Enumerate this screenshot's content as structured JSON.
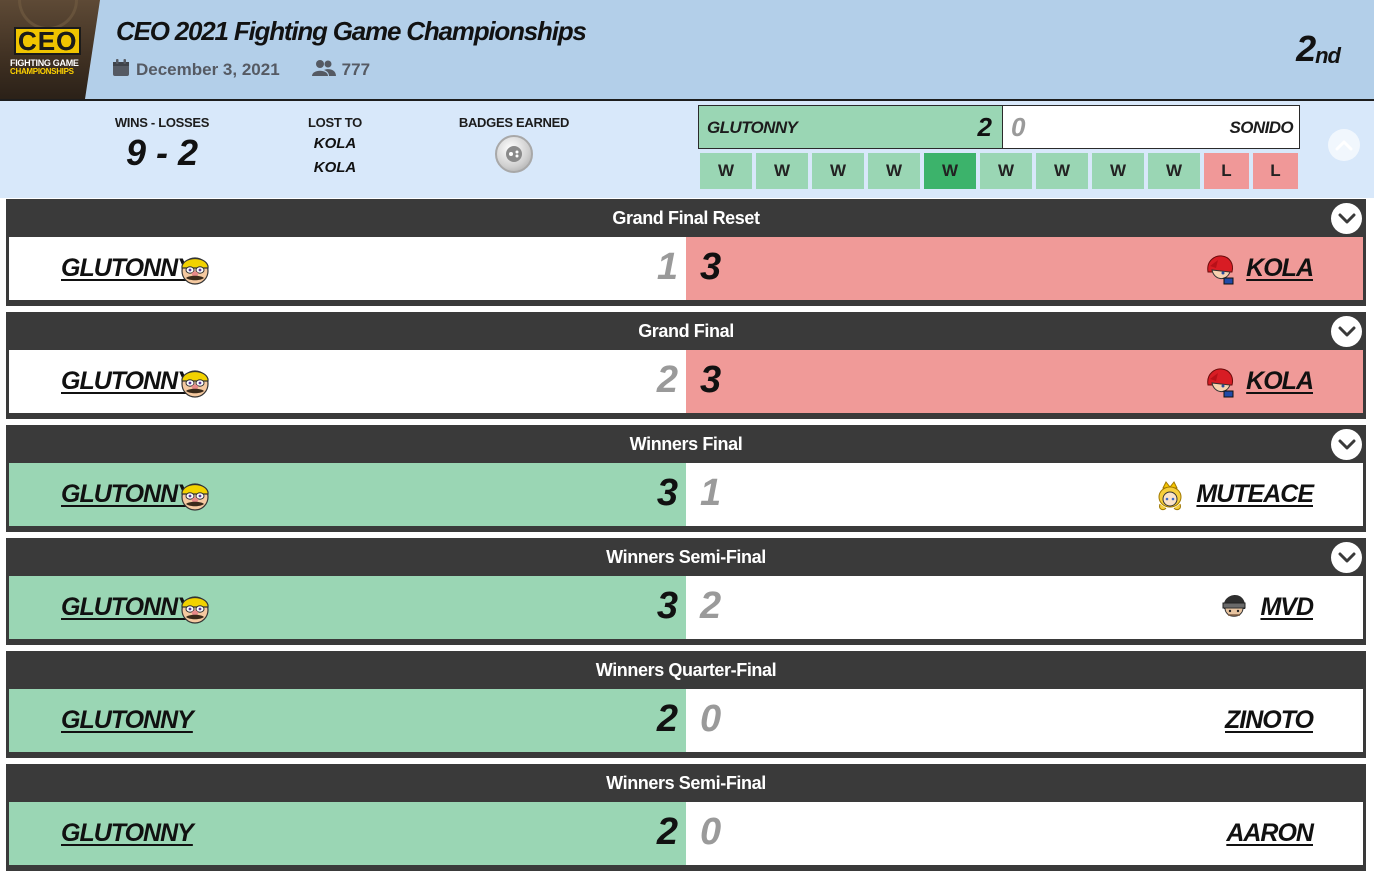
{
  "event": {
    "logo_text": "CEO",
    "logo_sub1": "FIGHTING GAME",
    "logo_sub2": "CHAMPIONSHIPS",
    "title": "CEO 2021 Fighting Game Championships",
    "date": "December 3, 2021",
    "entrants": "777",
    "placement_num": "2",
    "placement_suffix": "nd"
  },
  "stats": {
    "wl_label": "WINS - LOSSES",
    "wl_value": "9 - 2",
    "lost_to_label": "LOST TO",
    "lost_to": [
      "KOLA",
      "KOLA"
    ],
    "badges_label": "BADGES EARNED"
  },
  "mini_scoreboard": {
    "left_name": "GLUTONNY",
    "left_score": "2",
    "right_score": "0",
    "right_name": "SONIDO"
  },
  "results": [
    {
      "label": "W",
      "type": "w"
    },
    {
      "label": "W",
      "type": "w"
    },
    {
      "label": "W",
      "type": "w"
    },
    {
      "label": "W",
      "type": "w"
    },
    {
      "label": "W",
      "type": "w-hl"
    },
    {
      "label": "W",
      "type": "w"
    },
    {
      "label": "W",
      "type": "w"
    },
    {
      "label": "W",
      "type": "w"
    },
    {
      "label": "W",
      "type": "w"
    },
    {
      "label": "L",
      "type": "l"
    },
    {
      "label": "L",
      "type": "l"
    }
  ],
  "colors": {
    "header_bg": "#b3cfe9",
    "stats_bg": "#d8e8fa",
    "win_green": "#9ad6b4",
    "highlight_green": "#3cb36b",
    "loss_red": "#f09a98",
    "card_dark": "#3a3a3a"
  },
  "matches": [
    {
      "round": "Grand Final Reset",
      "p1": "GLUTONNY",
      "p1_score": "1",
      "p2_score": "3",
      "p2": "KOLA",
      "winner": "p2",
      "p1_icon": "wario-icon",
      "p2_icon": "roy-icon",
      "expandable": true
    },
    {
      "round": "Grand Final",
      "p1": "GLUTONNY",
      "p1_score": "2",
      "p2_score": "3",
      "p2": "KOLA",
      "winner": "p2",
      "p1_icon": "wario-icon",
      "p2_icon": "roy-icon",
      "expandable": true
    },
    {
      "round": "Winners Final",
      "p1": "GLUTONNY",
      "p1_score": "3",
      "p2_score": "1",
      "p2": "MUTEACE",
      "winner": "p1",
      "p1_icon": "wario-icon",
      "p2_icon": "peach-icon",
      "expandable": true
    },
    {
      "round": "Winners Semi-Final",
      "p1": "GLUTONNY",
      "p1_score": "3",
      "p2_score": "2",
      "p2": "MVD",
      "winner": "p1",
      "p1_icon": "wario-icon",
      "p2_icon": "snake-icon",
      "expandable": true
    },
    {
      "round": "Winners Quarter-Final",
      "p1": "GLUTONNY",
      "p1_score": "2",
      "p2_score": "0",
      "p2": "ZINOTO",
      "winner": "p1",
      "p1_icon": "",
      "p2_icon": "",
      "expandable": false
    },
    {
      "round": "Winners Semi-Final",
      "p1": "GLUTONNY",
      "p1_score": "2",
      "p2_score": "0",
      "p2": "AARON",
      "winner": "p1",
      "p1_icon": "",
      "p2_icon": "",
      "expandable": false
    }
  ]
}
